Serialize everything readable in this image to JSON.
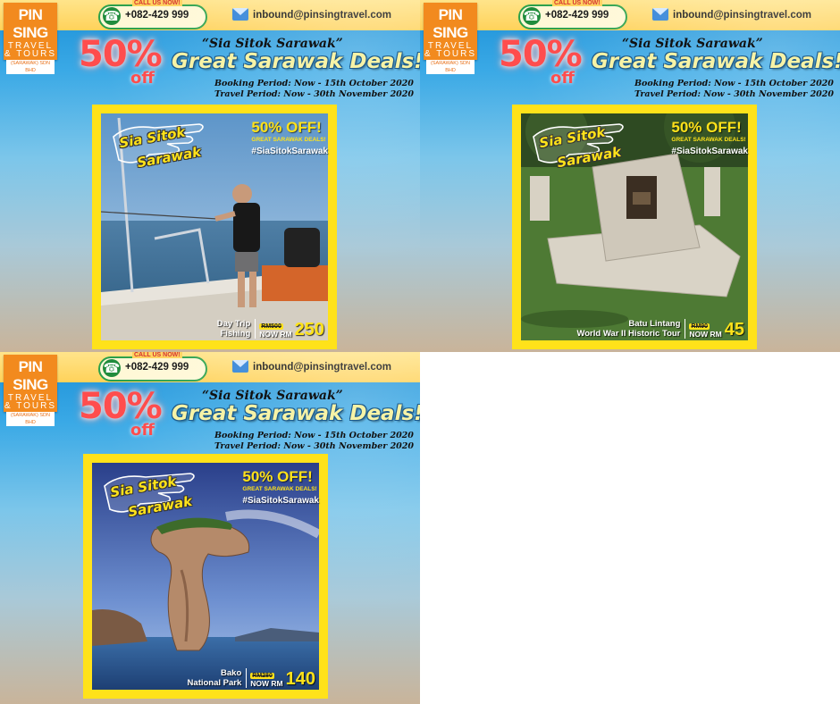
{
  "brand": {
    "name": "PIN SING",
    "subname": "TRAVEL & TOURS",
    "company": "(SARAWAK) SDN BHD"
  },
  "contact": {
    "call_label": "CALL US NOW!",
    "phone": "+082-429 999",
    "email": "inbound@pinsingtravel.com"
  },
  "promo": {
    "discount": "50%",
    "off_label": "off",
    "quote": "“Sia Sitok Sarawak”",
    "headline": "Great Sarawak Deals!",
    "booking_period": "Booking Period: Now - 15th October 2020",
    "travel_period": "Travel Period: Now - 30th November 2020",
    "tag_line1": "Sia Sitok",
    "tag_line2": "Sarawak",
    "badge_title": "50% OFF!",
    "badge_sub": "GREAT SARAWAK DEALS!",
    "hashtag": "#SiaSitokSarawak",
    "now_label": "NOW RM"
  },
  "colors": {
    "brand_orange": "#f28a1e",
    "frame_yellow": "#ffe21a",
    "discount_red": "#ff4d4d"
  },
  "cards": [
    {
      "place_line1": "Day Trip",
      "place_line2": "Fishing",
      "old_price": "RM500",
      "new_price": "250",
      "scene": "fishing"
    },
    {
      "place_line1": "Batu Lintang",
      "place_line2": "World War II Historic Tour",
      "old_price": "RM90",
      "new_price": "45",
      "scene": "monument"
    },
    {
      "place_line1": "Bako",
      "place_line2": "National Park",
      "old_price": "RM280",
      "new_price": "140",
      "scene": "bako"
    }
  ]
}
